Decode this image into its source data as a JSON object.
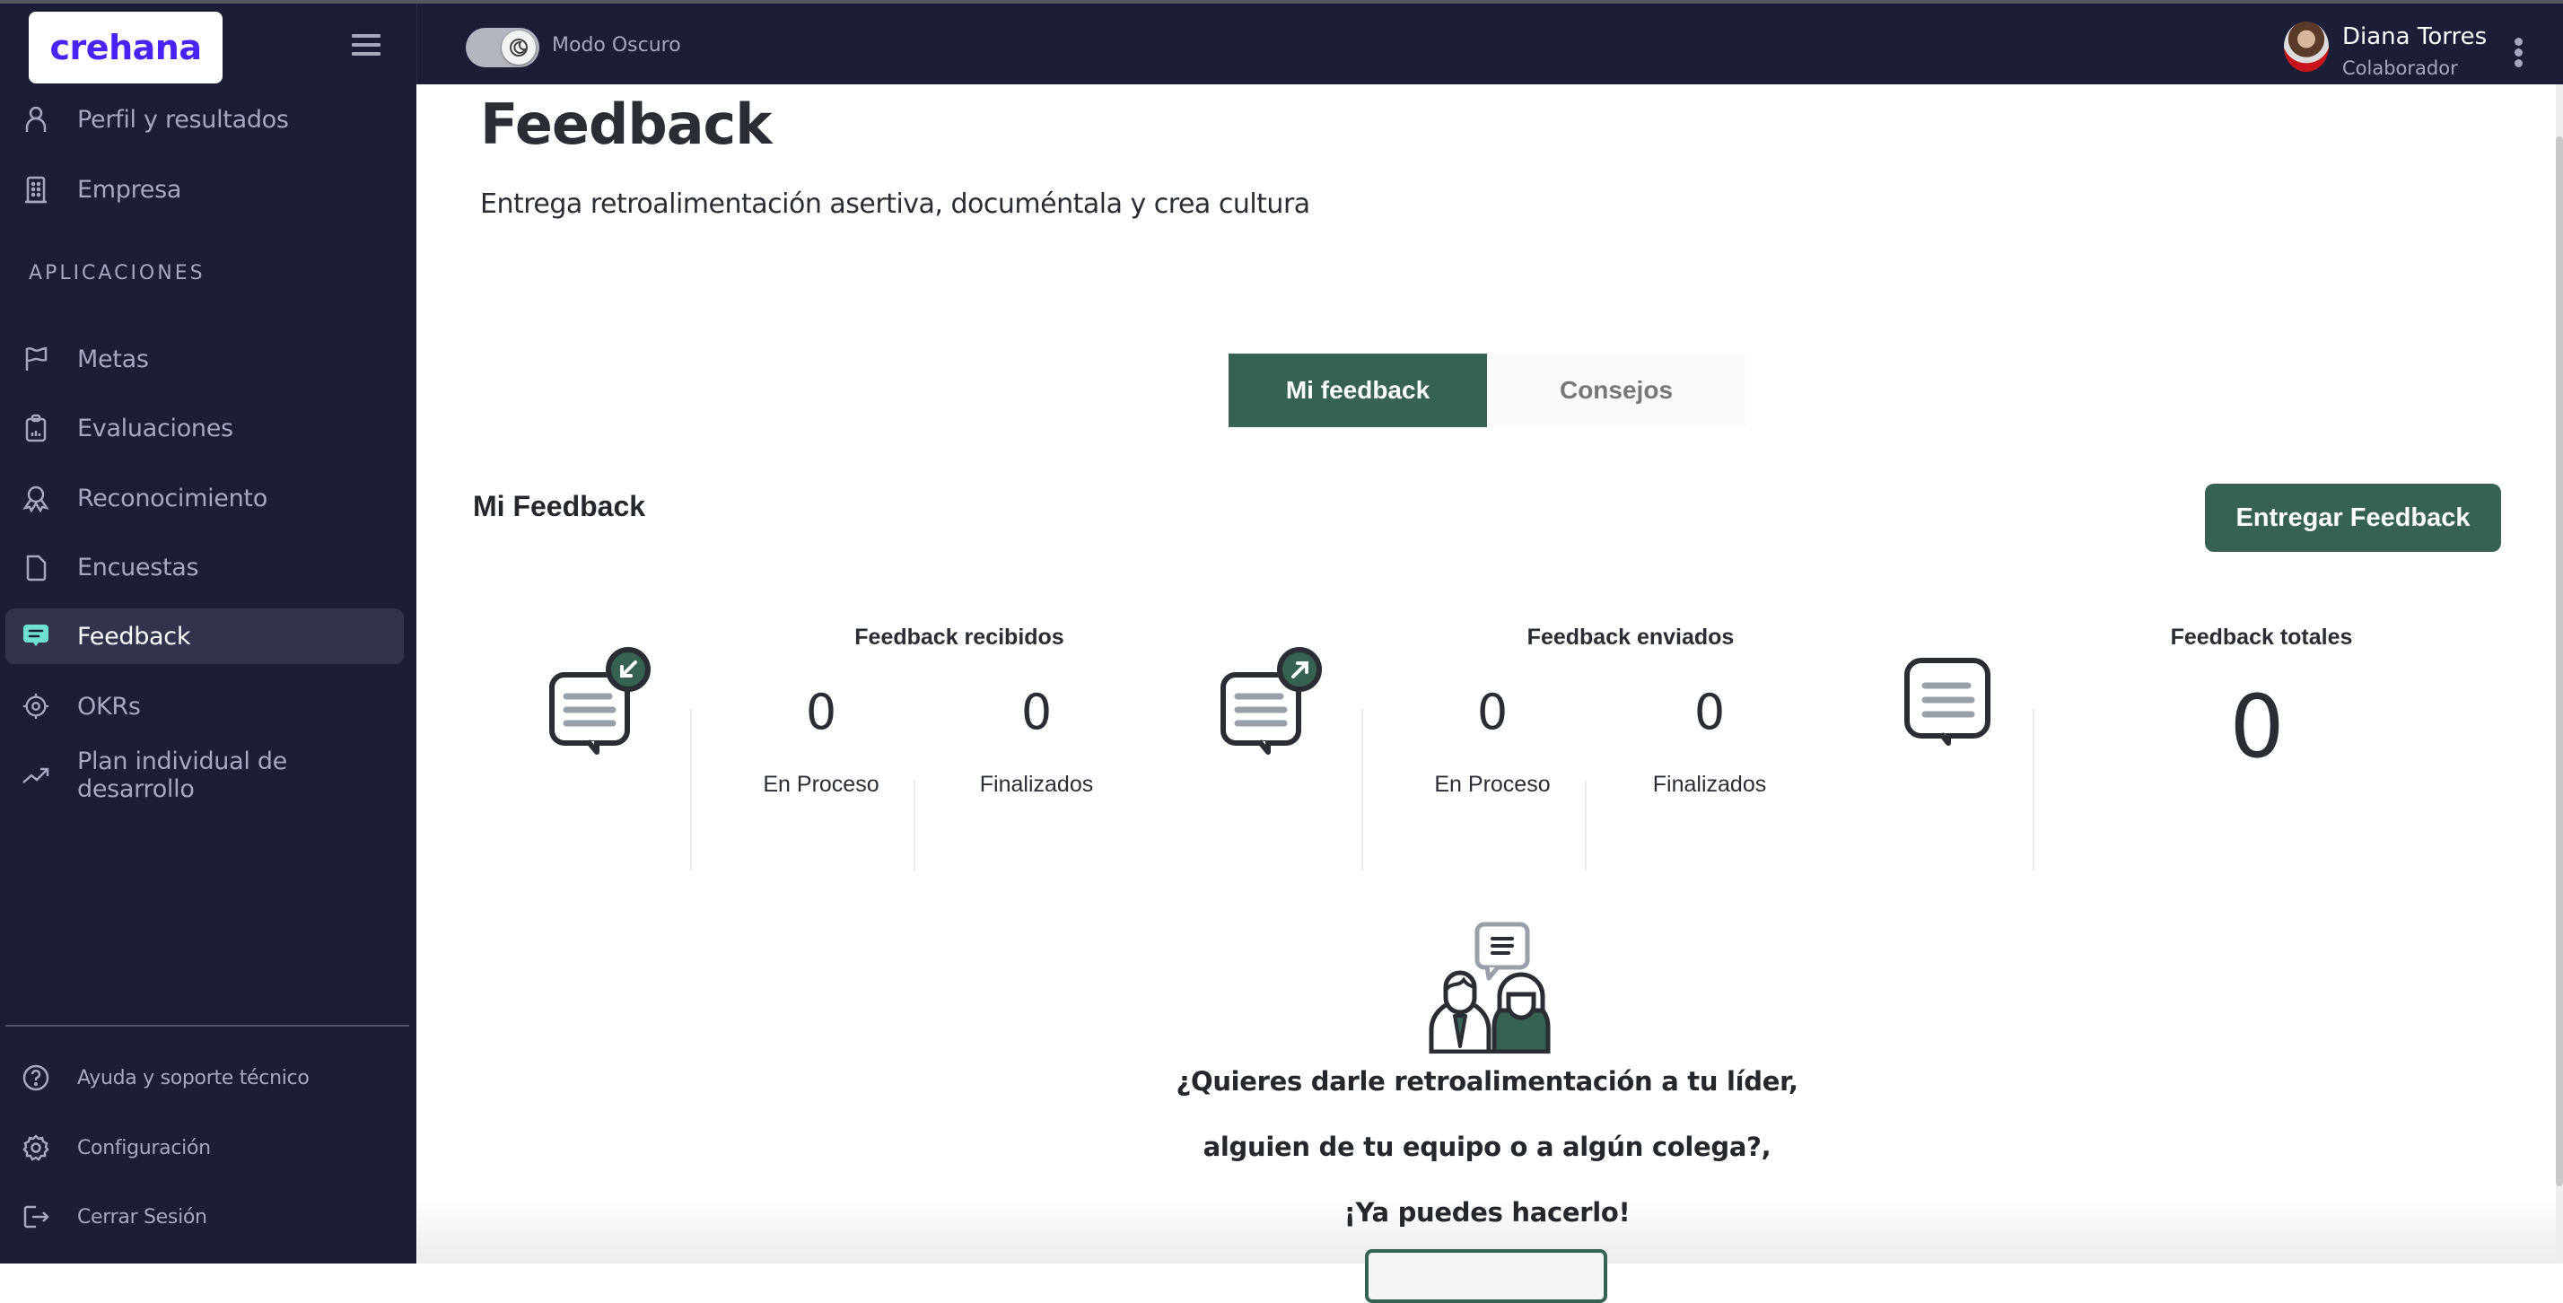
{
  "sidebar": {
    "logo": "crehana",
    "top_items": [
      {
        "label": "Perfil y resultados",
        "icon": "user-icon"
      },
      {
        "label": "Empresa",
        "icon": "building-icon"
      }
    ],
    "section_label": "APLICACIONES",
    "app_items": [
      {
        "label": "Metas",
        "icon": "flag-icon"
      },
      {
        "label": "Evaluaciones",
        "icon": "clipboard-chart-icon"
      },
      {
        "label": "Reconocimiento",
        "icon": "award-icon"
      },
      {
        "label": "Encuestas",
        "icon": "file-icon"
      },
      {
        "label": "Feedback",
        "icon": "chat-icon",
        "active": true
      },
      {
        "label": "OKRs",
        "icon": "target-icon"
      },
      {
        "label": "Plan individual de desarrollo",
        "icon": "trending-up-icon"
      }
    ],
    "bottom_items": [
      {
        "label": "Ayuda y soporte técnico",
        "icon": "help-icon"
      },
      {
        "label": "Configuración",
        "icon": "gear-icon"
      },
      {
        "label": "Cerrar Sesión",
        "icon": "logout-icon"
      }
    ]
  },
  "topbar": {
    "dark_mode_label": "Modo Oscuro",
    "dark_mode_on": false,
    "user_name": "Diana Torres",
    "user_role": "Colaborador"
  },
  "page": {
    "title": "Feedback",
    "subtitle": "Entrega retroalimentación asertiva, documéntala y crea cultura",
    "tabs": [
      {
        "label": "Mi feedback",
        "active": true
      },
      {
        "label": "Consejos",
        "active": false
      }
    ],
    "section_title": "Mi Feedback",
    "cta_label": "Entregar Feedback",
    "stats": {
      "received": {
        "title": "Feedback recibidos",
        "in_process": "0",
        "in_process_label": "En Proceso",
        "finished": "0",
        "finished_label": "Finalizados"
      },
      "sent": {
        "title": "Feedback enviados",
        "in_process": "0",
        "in_process_label": "En Proceso",
        "finished": "0",
        "finished_label": "Finalizados"
      },
      "total": {
        "title": "Feedback totales",
        "value": "0"
      }
    },
    "promo": {
      "line1": "¿Quieres darle retroalimentación a tu líder,",
      "line2": "alguien de tu equipo o a algún colega?,",
      "line3": "¡Ya puedes hacerlo!"
    }
  },
  "colors": {
    "sidebar_bg": "#1c1d37",
    "brand_green": "#356251",
    "logo_purple": "#4b22f4",
    "active_icon": "#6ee0d2"
  }
}
